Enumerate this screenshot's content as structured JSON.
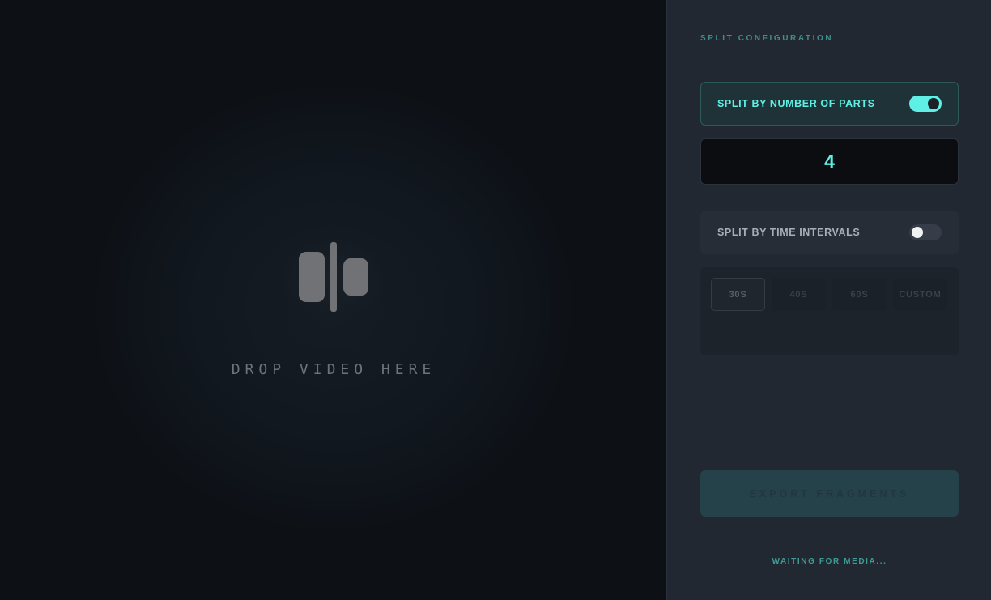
{
  "dropzone": {
    "label": "DROP VIDEO HERE",
    "icon": "split-video-icon"
  },
  "panel": {
    "title": "SPLIT CONFIGURATION",
    "split_by_parts": {
      "label": "SPLIT BY NUMBER OF PARTS",
      "enabled": true,
      "value": "4"
    },
    "split_by_time": {
      "label": "SPLIT BY TIME INTERVALS",
      "enabled": false,
      "options": [
        "30S",
        "40S",
        "60S",
        "CUSTOM"
      ],
      "selected": "30S"
    },
    "export_label": "EXPORT FRAGMENTS",
    "status": "WAITING FOR MEDIA..."
  },
  "colors": {
    "accent": "#5ef0e4",
    "panel_bg": "#212832",
    "dropzone_bg": "#121820",
    "muted_teal": "#3f8f8c"
  }
}
